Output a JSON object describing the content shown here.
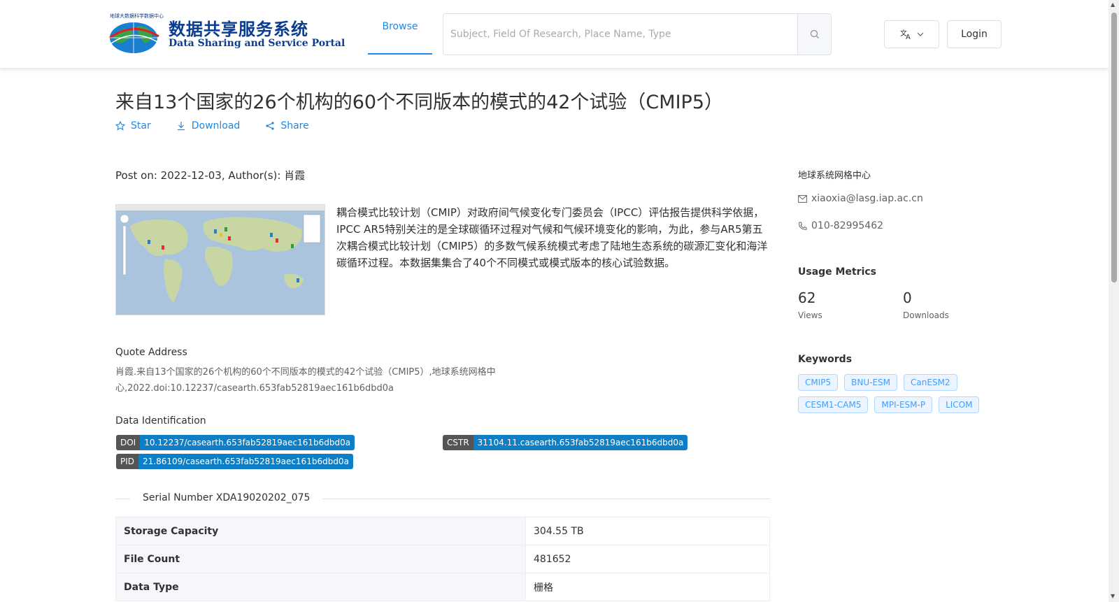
{
  "header": {
    "logo": {
      "cn": "数据共享服务系统",
      "en": "Data Sharing and Service Portal",
      "tiny": "地球大数据科学数据中心"
    },
    "nav": {
      "browse": "Browse"
    },
    "search": {
      "placeholder": "Subject, Field Of Research, Place Name, Type"
    },
    "login": "Login"
  },
  "title": "来自13个国家的26个机构的60个不同版本的模式的42个试验（CMIP5）",
  "actions": {
    "star": "Star",
    "download": "Download",
    "share": "Share"
  },
  "post_on": "Post on: 2022-12-03, Author(s): 肖霞",
  "description": "耦合模式比较计划（CMIP）对政府间气候变化专门委员会（IPCC）评估报告提供科学依据，IPCC AR5特别关注的是全球碳循环过程对气候和气候环境变化的影响，为此，参与AR5第五次耦合模式比较计划（CMIP5）的多数气候系统模式考虑了陆地生态系统的碳源汇变化和海洋碳循环过程。本数据集集合了40个不同模式或模式版本的核心试验数据。",
  "quote": {
    "title": "Quote Address",
    "text": "肖霞.来自13个国家的26个机构的60个不同版本的模式的42个试验（CMIP5）,地球系统网格中心,2022.doi:10.12237/casearth.653fab52819aec161b6dbd0a"
  },
  "identification": {
    "title": "Data Identification",
    "doi": {
      "key": "DOI",
      "value": "10.12237/casearth.653fab52819aec161b6dbd0a"
    },
    "cstr": {
      "key": "CSTR",
      "value": "31104.11.casearth.653fab52819aec161b6dbd0a"
    },
    "pid": {
      "key": "PID",
      "value": "21.86109/casearth.653fab52819aec161b6dbd0a"
    }
  },
  "serial": "Serial Number XDA19020202_075",
  "info_rows": [
    {
      "label": "Storage Capacity",
      "value": "304.55 TB"
    },
    {
      "label": "File Count",
      "value": "481652"
    },
    {
      "label": "Data Type",
      "value": "栅格"
    }
  ],
  "sidebar": {
    "org": "地球系统网格中心",
    "email": "xiaoxia@lasg.iap.ac.cn",
    "phone": "010-82995462",
    "usage_title": "Usage Metrics",
    "views": {
      "value": "62",
      "label": "Views"
    },
    "downloads": {
      "value": "0",
      "label": "Downloads"
    },
    "keywords_title": "Keywords",
    "keywords": [
      "CMIP5",
      "BNU-ESM",
      "CanESM2",
      "CESM1-CAM5",
      "MPI-ESM-P",
      "LICOM"
    ]
  },
  "colors": {
    "accent": "#1e88e5",
    "badge_value": "#0e7fc6",
    "badge_key": "#555555"
  }
}
